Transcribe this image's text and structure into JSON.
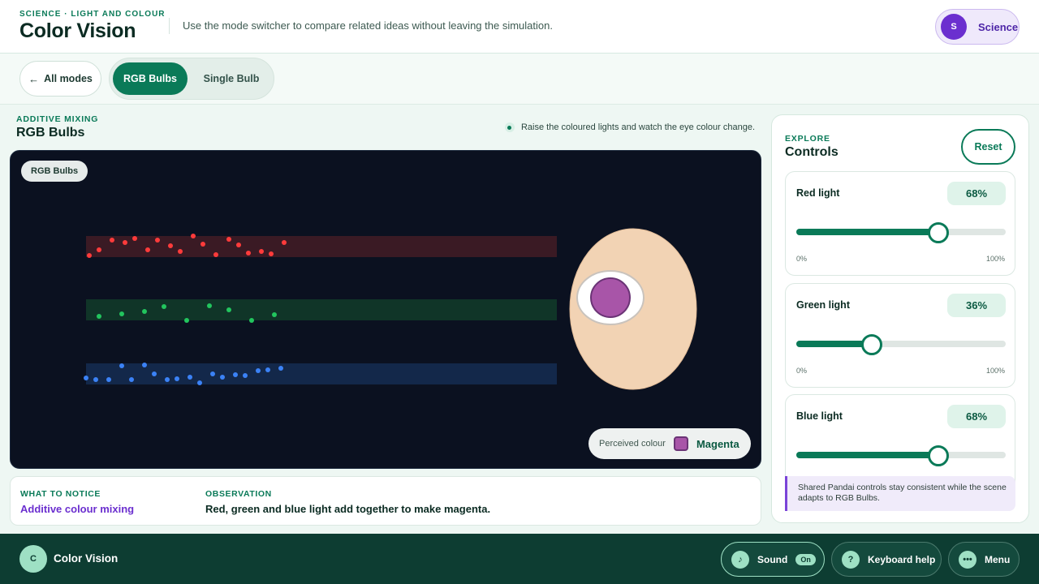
{
  "header": {
    "eyebrow": "SCIENCE · LIGHT AND COLOUR",
    "title": "Color Vision",
    "subtitle": "Use the mode switcher to compare related ideas without leaving the simulation.",
    "subject": {
      "initial": "S",
      "label": "Science"
    }
  },
  "modebar": {
    "all_modes": "All modes",
    "back_icon": "arrow-left-icon",
    "modes": [
      {
        "label": "RGB Bulbs",
        "active": true
      },
      {
        "label": "Single Bulb",
        "active": false
      }
    ]
  },
  "scene": {
    "eyebrow": "ADDITIVE MIXING",
    "title": "RGB Bulbs",
    "hint": "Raise the coloured lights and watch the eye colour change.",
    "stage_chip": "RGB Bulbs",
    "perceived_label": "Perceived colour",
    "perceived_value": "Magenta",
    "perceived_color": "#a855a8",
    "beam_colors": {
      "red": "#ff3b3b",
      "green": "#22c55e",
      "blue": "#3b82f6"
    },
    "iris_color": "#a855a8",
    "skin_color": "#f2d3b4"
  },
  "notice": {
    "what_label": "WHAT TO NOTICE",
    "what_value": "Additive colour mixing",
    "obs_label": "OBSERVATION",
    "obs_value": "Red, green and blue light add together to make magenta."
  },
  "controls": {
    "eyebrow": "EXPLORE",
    "title": "Controls",
    "reset": "Reset",
    "sliders": [
      {
        "label": "Red light",
        "value": 0.68,
        "display": "68%",
        "min": "0%",
        "max": "100%"
      },
      {
        "label": "Green light",
        "value": 0.36,
        "display": "36%",
        "min": "0%",
        "max": "100%"
      },
      {
        "label": "Blue light",
        "value": 0.68,
        "display": "68%"
      }
    ],
    "note": "Shared Pandai controls stay consistent while the scene adapts to RGB Bulbs."
  },
  "footer": {
    "initial": "C",
    "title": "Color Vision",
    "sound": {
      "label": "Sound",
      "state": "On",
      "icon": "music-note-icon"
    },
    "keyboard": {
      "label": "Keyboard help",
      "icon": "question-icon"
    },
    "menu": {
      "label": "Menu",
      "icon": "more-dots-icon"
    }
  },
  "colors": {
    "accent": "#0a7a58",
    "purple": "#6b2fcf",
    "footer": "#0d3d32"
  }
}
